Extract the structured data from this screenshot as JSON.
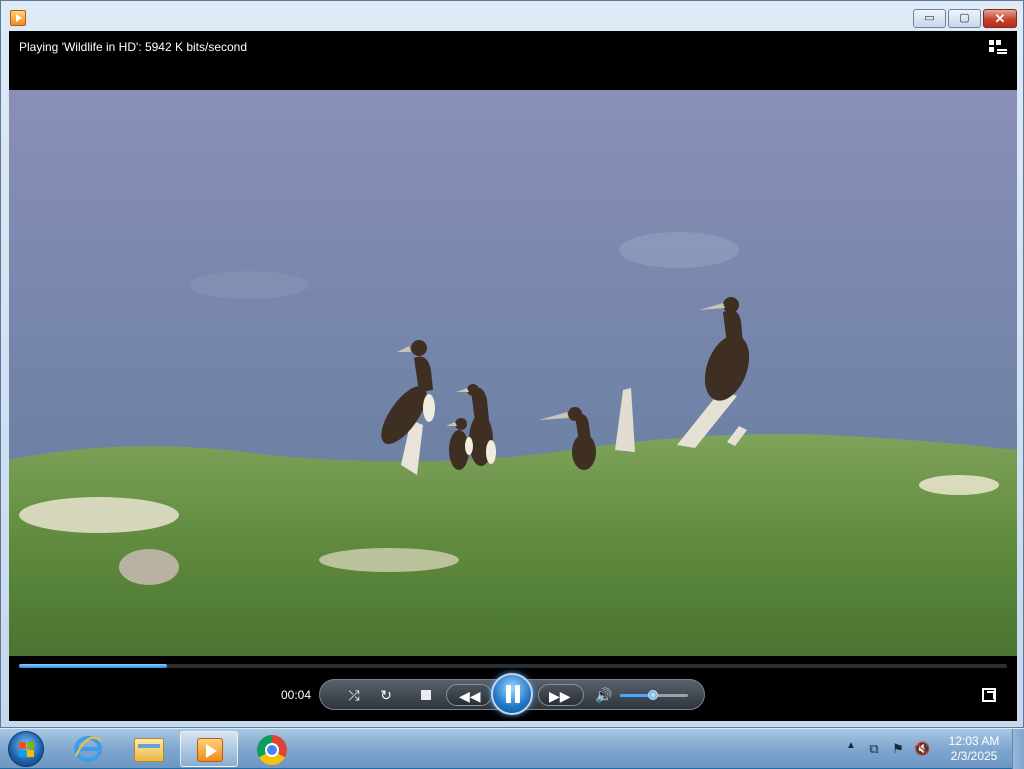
{
  "window": {
    "title_icon": "media-player-icon",
    "controls": {
      "minimize": "▭",
      "maximize": "▢",
      "close": "✕"
    }
  },
  "player": {
    "status": "Playing 'Wildlife in HD': 5942 K bits/second",
    "elapsed": "00:04",
    "seek_progress": 0.15,
    "volume_level": 0.48,
    "colors": {
      "accent": "#2b8de0"
    }
  },
  "taskbar": {
    "items": [
      "internet-explorer-icon",
      "file-explorer-icon",
      "media-player-icon",
      "chrome-icon"
    ],
    "clock": {
      "time": "12:03 AM",
      "date": "2/3/2025"
    }
  }
}
